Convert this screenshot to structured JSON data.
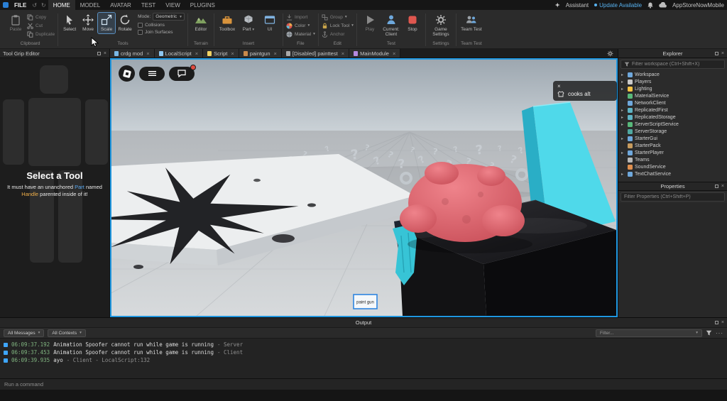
{
  "colors": {
    "accent_blue": "#2a7fd4",
    "viewport_border": "#1f97e0",
    "update_blue": "#58b2f0",
    "stop_red": "#e0574f",
    "selection_blue": "#2f86e0"
  },
  "titlebar": {
    "file_label": "FILE",
    "tabs": [
      {
        "label": "HOME"
      },
      {
        "label": "MODEL"
      },
      {
        "label": "AVATAR"
      },
      {
        "label": "TEST"
      },
      {
        "label": "VIEW"
      },
      {
        "label": "PLUGINS"
      }
    ],
    "assistant_label": "Assistant",
    "update_label": "Update Available",
    "username": "AppStoreNowMobile"
  },
  "ribbon": {
    "clipboard": {
      "group": "Clipboard",
      "paste": "Paste",
      "copy": "Copy",
      "cut": "Cut",
      "duplicate": "Duplicate"
    },
    "tools": {
      "group": "Tools",
      "select": "Select",
      "move": "Move",
      "scale": "Scale",
      "rotate": "Rotate",
      "mode_label": "Mode:",
      "mode_value": "Geometric",
      "collisions": "Collisions",
      "join_surfaces": "Join Surfaces"
    },
    "terrain": {
      "group": "Terrain",
      "editor": "Editor"
    },
    "insert": {
      "group": "Insert",
      "toolbox": "Toolbox",
      "part": "Part",
      "ui": "UI"
    },
    "file": {
      "group": "File",
      "import": "Import",
      "color": "Color",
      "material": "Material"
    },
    "edit": {
      "group": "Edit",
      "group_btn": "Group",
      "lock": "Lock Tool",
      "anchor": "Anchor"
    },
    "test": {
      "group": "Test",
      "play": "Play",
      "current_line1": "Current:",
      "current_line2": "Client",
      "stop": "Stop"
    },
    "settings": {
      "group": "Settings",
      "label": "Game Settings"
    },
    "team_test": {
      "group": "Team Test",
      "label": "Team Test"
    }
  },
  "tool_grip": {
    "title": "Tool Grip Editor",
    "heading": "Select a Tool",
    "line1_pre": "It must have an unanchored ",
    "line1_part": "Part",
    "line1_post": " named",
    "line2_handle": "Handle",
    "line2_post": " parented inside of it!"
  },
  "doc_tabs": [
    {
      "label": "crdg mod",
      "color": "#7ab8e6"
    },
    {
      "label": "LocalScript",
      "color": "#8ec7f0"
    },
    {
      "label": "Script",
      "color": "#f0d264"
    },
    {
      "label": "paintgun",
      "color": "#c98a4b"
    },
    {
      "label": "[Disabled] painttest",
      "color": "#a9a9a9"
    },
    {
      "label": "MainModule",
      "color": "#b48ae0"
    }
  ],
  "viewport": {
    "player_tooltip": "cooks alt",
    "selection_label": "paint gun"
  },
  "explorer": {
    "title": "Explorer",
    "filter_placeholder": "Filter workspace (Ctrl+Shift+X)",
    "items": [
      {
        "label": "Workspace",
        "color": "#6fa8dc"
      },
      {
        "label": "Players",
        "color": "#c9c9c9"
      },
      {
        "label": "Lighting",
        "color": "#f6c244"
      },
      {
        "label": "MaterialService",
        "color": "#58b87a"
      },
      {
        "label": "NetworkClient",
        "color": "#6fa8dc"
      },
      {
        "label": "ReplicatedFirst",
        "color": "#5fb3c4"
      },
      {
        "label": "ReplicatedStorage",
        "color": "#5fb3c4"
      },
      {
        "label": "ServerScriptService",
        "color": "#58b87a"
      },
      {
        "label": "ServerStorage",
        "color": "#4fa8a0"
      },
      {
        "label": "StarterGui",
        "color": "#6fa8dc"
      },
      {
        "label": "StarterPack",
        "color": "#c79b5e"
      },
      {
        "label": "StarterPlayer",
        "color": "#6fa8dc"
      },
      {
        "label": "Teams",
        "color": "#b8b8b8"
      },
      {
        "label": "SoundService",
        "color": "#e08f4e"
      },
      {
        "label": "TextChatService",
        "color": "#6fa8dc"
      }
    ]
  },
  "properties": {
    "title": "Properties",
    "filter_placeholder": "Filter Properties (Ctrl+Shift+P)"
  },
  "output": {
    "title": "Output",
    "messages_dropdown": "All Messages",
    "contexts_dropdown": "All Contexts",
    "filter_placeholder": "Filter...",
    "lines": [
      {
        "time": "06:09:37.192",
        "text": "Animation Spoofer cannot run while game is running",
        "suffix": "-  Server"
      },
      {
        "time": "06:09:37.453",
        "text": "Animation Spoofer cannot run while game is running",
        "suffix": "-  Client"
      },
      {
        "time": "06:09:39.935",
        "text": "ayo",
        "suffix": "-  Client - LocalScript:132"
      }
    ]
  },
  "command_bar": {
    "placeholder": "Run a command"
  }
}
